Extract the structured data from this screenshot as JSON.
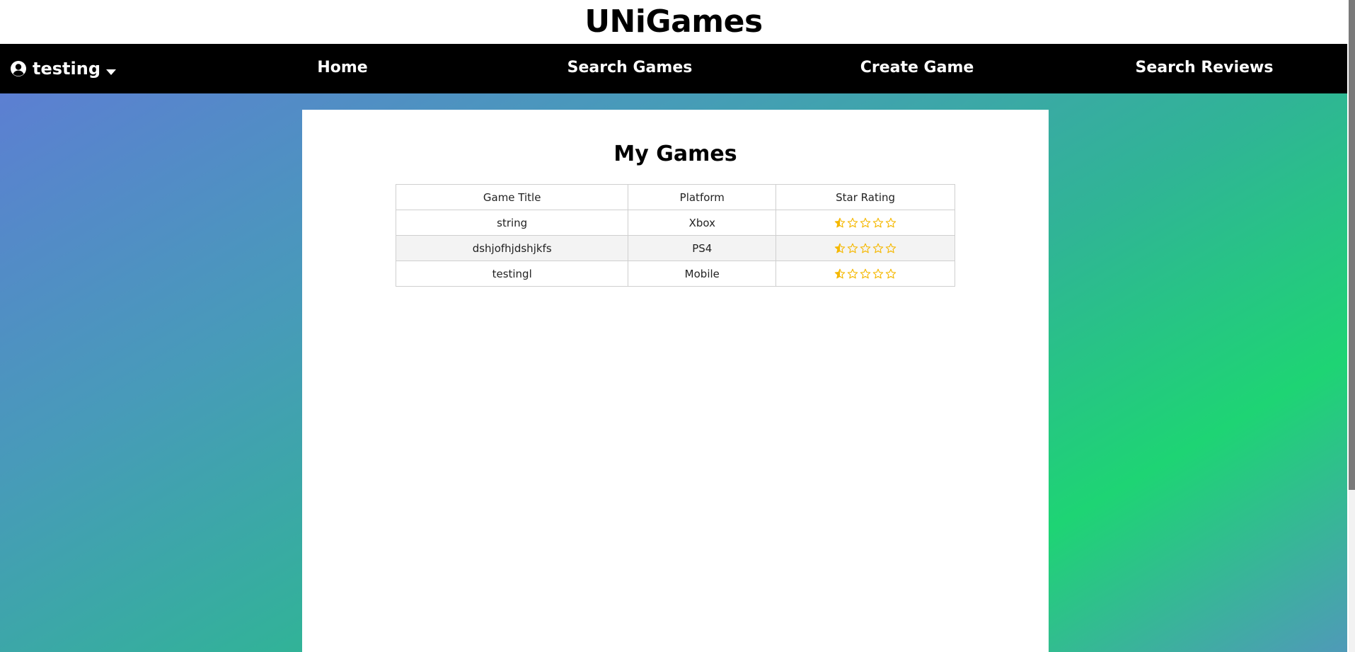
{
  "brand": {
    "title": "UNiGames"
  },
  "navbar": {
    "user": {
      "name": "testing",
      "icon": "user-circle-icon",
      "dropdown_icon": "caret-down-icon"
    },
    "links": [
      {
        "label": "Home"
      },
      {
        "label": "Search Games"
      },
      {
        "label": "Create Game"
      },
      {
        "label": "Search Reviews"
      }
    ]
  },
  "main": {
    "heading": "My Games",
    "table": {
      "headers": [
        "Game Title",
        "Platform",
        "Star Rating"
      ],
      "rows": [
        {
          "title": "string",
          "platform": "Xbox",
          "rating": 0.5
        },
        {
          "title": "dshjofhjdshjkfs",
          "platform": "PS4",
          "rating": 0.5
        },
        {
          "title": "testingl",
          "platform": "Mobile",
          "rating": 0.5
        }
      ],
      "rating_max": 5
    }
  },
  "colors": {
    "navbar_bg": "#000000",
    "star": "#f5b800",
    "gradient": [
      "#5c7fd2",
      "#30b496",
      "#1ed474"
    ]
  }
}
